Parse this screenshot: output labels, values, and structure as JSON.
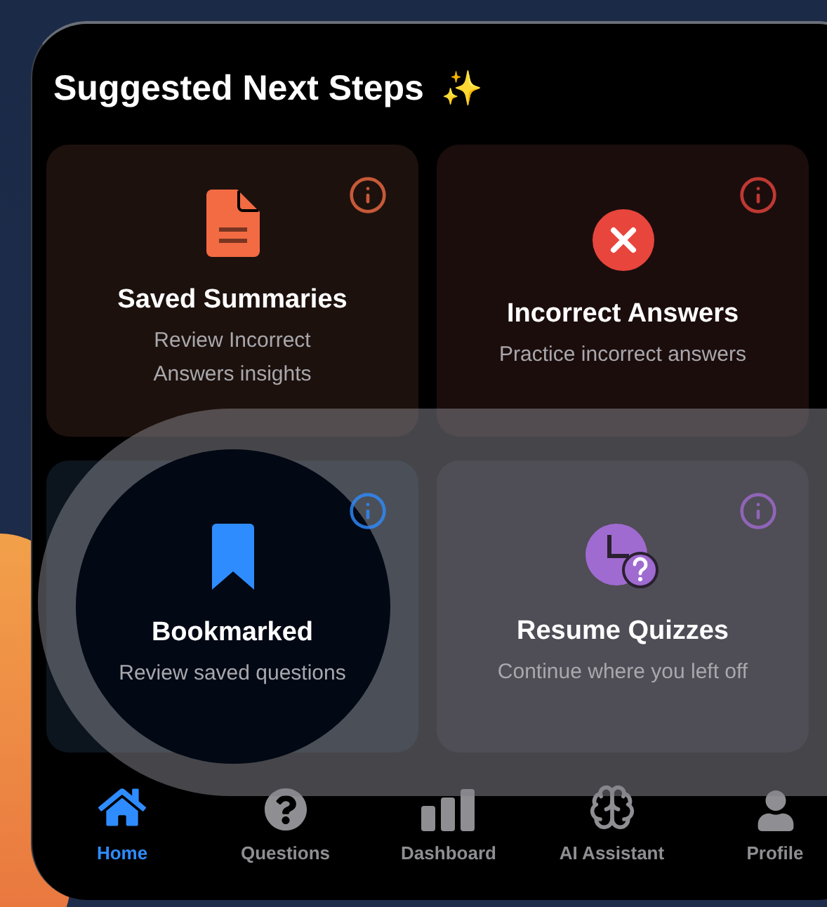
{
  "section": {
    "title": "Suggested Next Steps",
    "title_icon": "✨"
  },
  "cards": [
    {
      "kind": "document",
      "title": "Saved Summaries",
      "subtitle": "Review Incorrect Answers insights",
      "color": "#f26b43",
      "spotlighted": false
    },
    {
      "kind": "wrong",
      "title": "Incorrect Answers",
      "subtitle": "Practice incorrect answers",
      "color": "#e8453c",
      "spotlighted": false
    },
    {
      "kind": "bookmark",
      "title": "Bookmarked",
      "subtitle": "Review saved questions",
      "color": "#2f8cff",
      "spotlighted": true
    },
    {
      "kind": "clock",
      "title": "Resume Quizzes",
      "subtitle": "Continue where you left off",
      "color": "#a06bd0",
      "spotlighted": false
    }
  ],
  "tab_bar": [
    {
      "kind": "home",
      "label": "Home",
      "selected": true
    },
    {
      "kind": "questions",
      "label": "Questions",
      "selected": false
    },
    {
      "kind": "dashboard",
      "label": "Dashboard",
      "selected": false
    },
    {
      "kind": "assistant",
      "label": "AI Assistant",
      "selected": false
    },
    {
      "kind": "profile",
      "label": "Profile",
      "selected": false
    }
  ]
}
